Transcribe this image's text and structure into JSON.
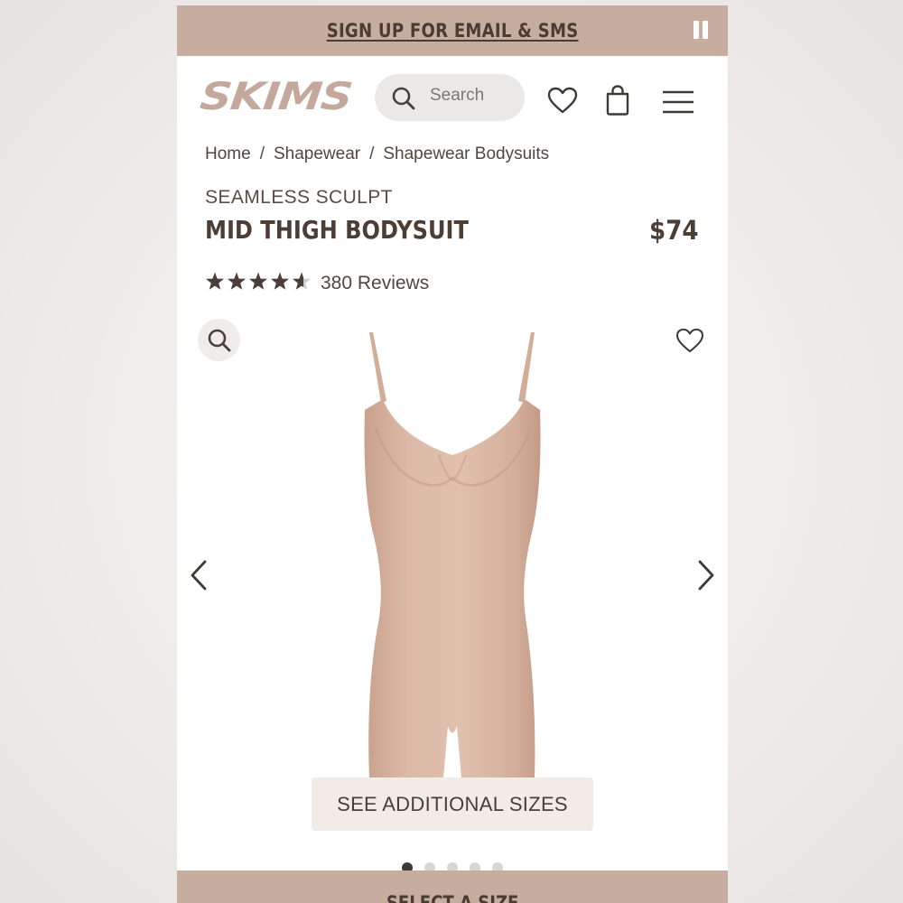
{
  "promo": {
    "text": "SIGN UP FOR EMAIL & SMS",
    "pause_icon": "pause-icon"
  },
  "header": {
    "logo": "SKIMS",
    "search_placeholder": "Search",
    "icons": [
      "search-icon",
      "heart-icon",
      "shopping-bag-icon",
      "menu-icon"
    ]
  },
  "breadcrumb": {
    "items": [
      "Home",
      "Shapewear",
      "Shapewear Bodysuits"
    ],
    "separator": "/"
  },
  "product": {
    "collection": "SEAMLESS SCULPT",
    "name": "MID THIGH BODYSUIT",
    "price": "$74",
    "rating": 4.6,
    "rating_max": 5,
    "reviews": "380 Reviews",
    "image_color": "#d8b6a2"
  },
  "gallery": {
    "see_sizes": "SEE ADDITIONAL SIZES",
    "dot_count": 5,
    "active_dot": 1
  },
  "cta": {
    "label": "SELECT A SIZE"
  },
  "colors": {
    "accent": "#c6ada0",
    "text_dark": "#4d3e35",
    "logo": "#c4a89b"
  }
}
